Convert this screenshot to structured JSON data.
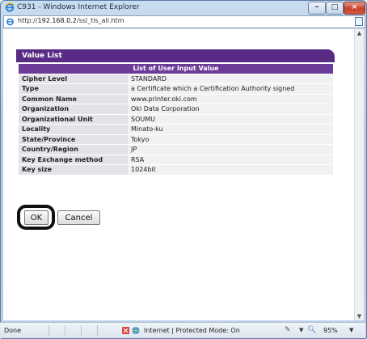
{
  "window": {
    "title": "C931 - Windows Internet Explorer",
    "controls": {
      "minimize": "–",
      "maximize": "□",
      "close": "×"
    }
  },
  "address_bar": {
    "url_prefix": "http://",
    "url_host": "192.168.0.2",
    "url_path": "/ssl_tls_all.htm"
  },
  "panel": {
    "header": "Value List",
    "table_caption": "List of User Input Value",
    "rows": [
      {
        "label": "Cipher Level",
        "value": "STANDARD"
      },
      {
        "label": "Type",
        "value": "a Certificate which a Certification Authority signed"
      },
      {
        "label": "Common Name",
        "value": "www.printer.oki.com"
      },
      {
        "label": "Organization",
        "value": "Oki Data Corporation"
      },
      {
        "label": "Organizational Unit",
        "value": "SOUMU"
      },
      {
        "label": "Locality",
        "value": "Minato-ku"
      },
      {
        "label": "State/Province",
        "value": "Tokyo"
      },
      {
        "label": "Country/Region",
        "value": "JP"
      },
      {
        "label": "Key Exchange method",
        "value": "RSA"
      },
      {
        "label": "Key size",
        "value": "1024bit"
      }
    ]
  },
  "buttons": {
    "ok": "OK",
    "cancel": "Cancel"
  },
  "status_bar": {
    "status": "Done",
    "zone": "Internet | Protected Mode: On",
    "zoom": "95%"
  },
  "colors": {
    "header_purple": "#5a2b84",
    "caption_purple": "#6c3a97"
  }
}
